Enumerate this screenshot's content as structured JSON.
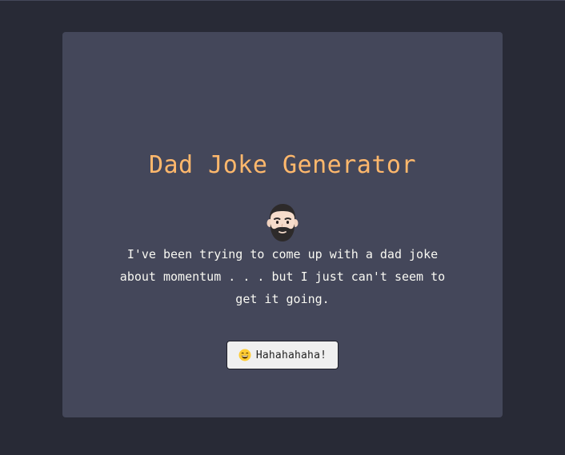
{
  "app": {
    "title": "Dad Joke Generator",
    "icon": "bearded-man-icon"
  },
  "joke": {
    "text": "I've been trying to come up with a dad joke about momentum . . . but I just can't seem to get it going."
  },
  "button": {
    "icon": "grinning-face-icon",
    "label": "Hahahahaha!"
  },
  "colors": {
    "background": "#282a36",
    "card": "#44475a",
    "title": "#ffb86c",
    "text": "#f8f8f2",
    "button_bg": "#f0f0f0"
  }
}
